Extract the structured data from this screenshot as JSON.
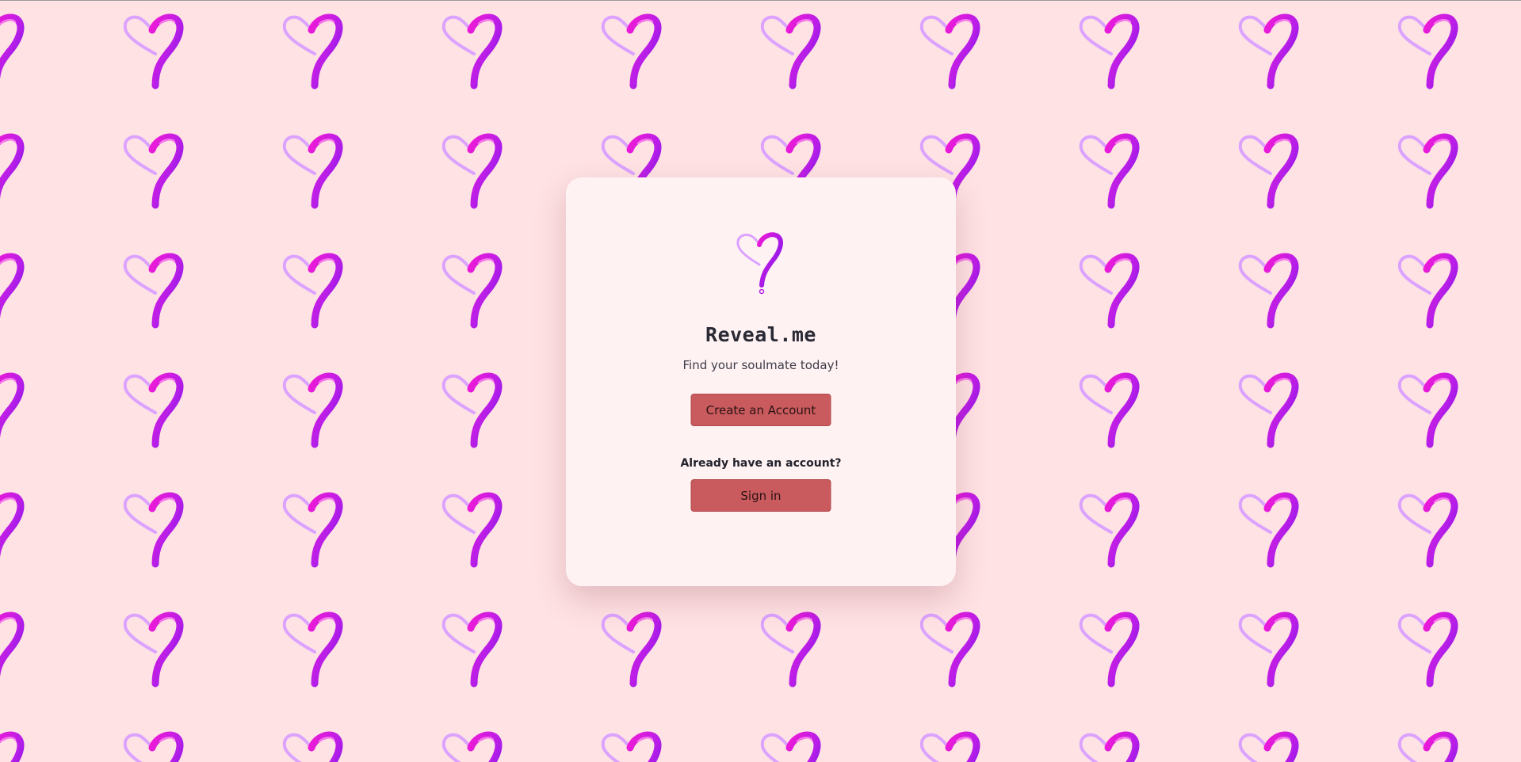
{
  "app": {
    "title": "Reveal.me",
    "tagline": "Find your soulmate today!"
  },
  "actions": {
    "create_account_label": "Create an Account",
    "existing_account_prompt": "Already have an account?",
    "sign_in_label": "Sign in"
  },
  "icons": {
    "logo": "heart-question-mark-icon",
    "background_tile": "heart-question-mark-icon"
  },
  "colors": {
    "page_background": "#ffe2e4",
    "card_background": "#fff2f3",
    "button_background": "#c95b5e",
    "logo_light": "#dba2ff",
    "logo_dark": "#8a14ec",
    "logo_accent": "#f01ad6"
  }
}
